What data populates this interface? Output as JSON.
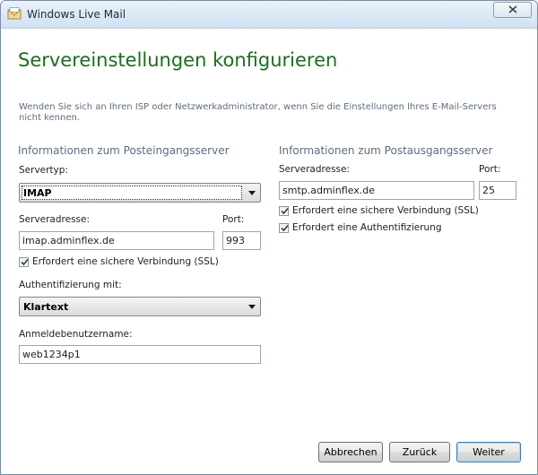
{
  "window": {
    "title": "Windows Live Mail",
    "app_icon": "windows-live-mail-icon",
    "close_icon": "close-icon"
  },
  "page": {
    "heading": "Servereinstellungen konfigurieren",
    "subtext": "Wenden Sie sich an Ihren ISP oder Netzwerkadministrator, wenn Sie die Einstellungen Ihres E-Mail-Servers nicht kennen."
  },
  "incoming": {
    "section_title": "Informationen zum Posteingangsserver",
    "server_type_label": "Servertyp:",
    "server_type_value": "IMAP",
    "server_address_label": "Serveradresse:",
    "server_address_value": "imap.adminflex.de",
    "port_label": "Port:",
    "port_value": "993",
    "ssl_label": "Erfordert eine sichere Verbindung (SSL)",
    "ssl_checked": true,
    "auth_label": "Authentifizierung mit:",
    "auth_value": "Klartext",
    "login_label": "Anmeldebenutzername:",
    "login_value": "web1234p1"
  },
  "outgoing": {
    "section_title": "Informationen zum Postausgangsserver",
    "server_address_label": "Serveradresse:",
    "server_address_value": "smtp.adminflex.de",
    "port_label": "Port:",
    "port_value": "25",
    "ssl_label": "Erfordert eine sichere Verbindung (SSL)",
    "ssl_checked": true,
    "auth_required_label": "Erfordert eine Authentifizierung",
    "auth_required_checked": true
  },
  "buttons": {
    "cancel": "Abbrechen",
    "back": "Zurück",
    "next": "Weiter"
  },
  "colors": {
    "heading": "#1a6f1a",
    "section_text": "#5b6d80",
    "titlebar": "#dbe7f5"
  }
}
